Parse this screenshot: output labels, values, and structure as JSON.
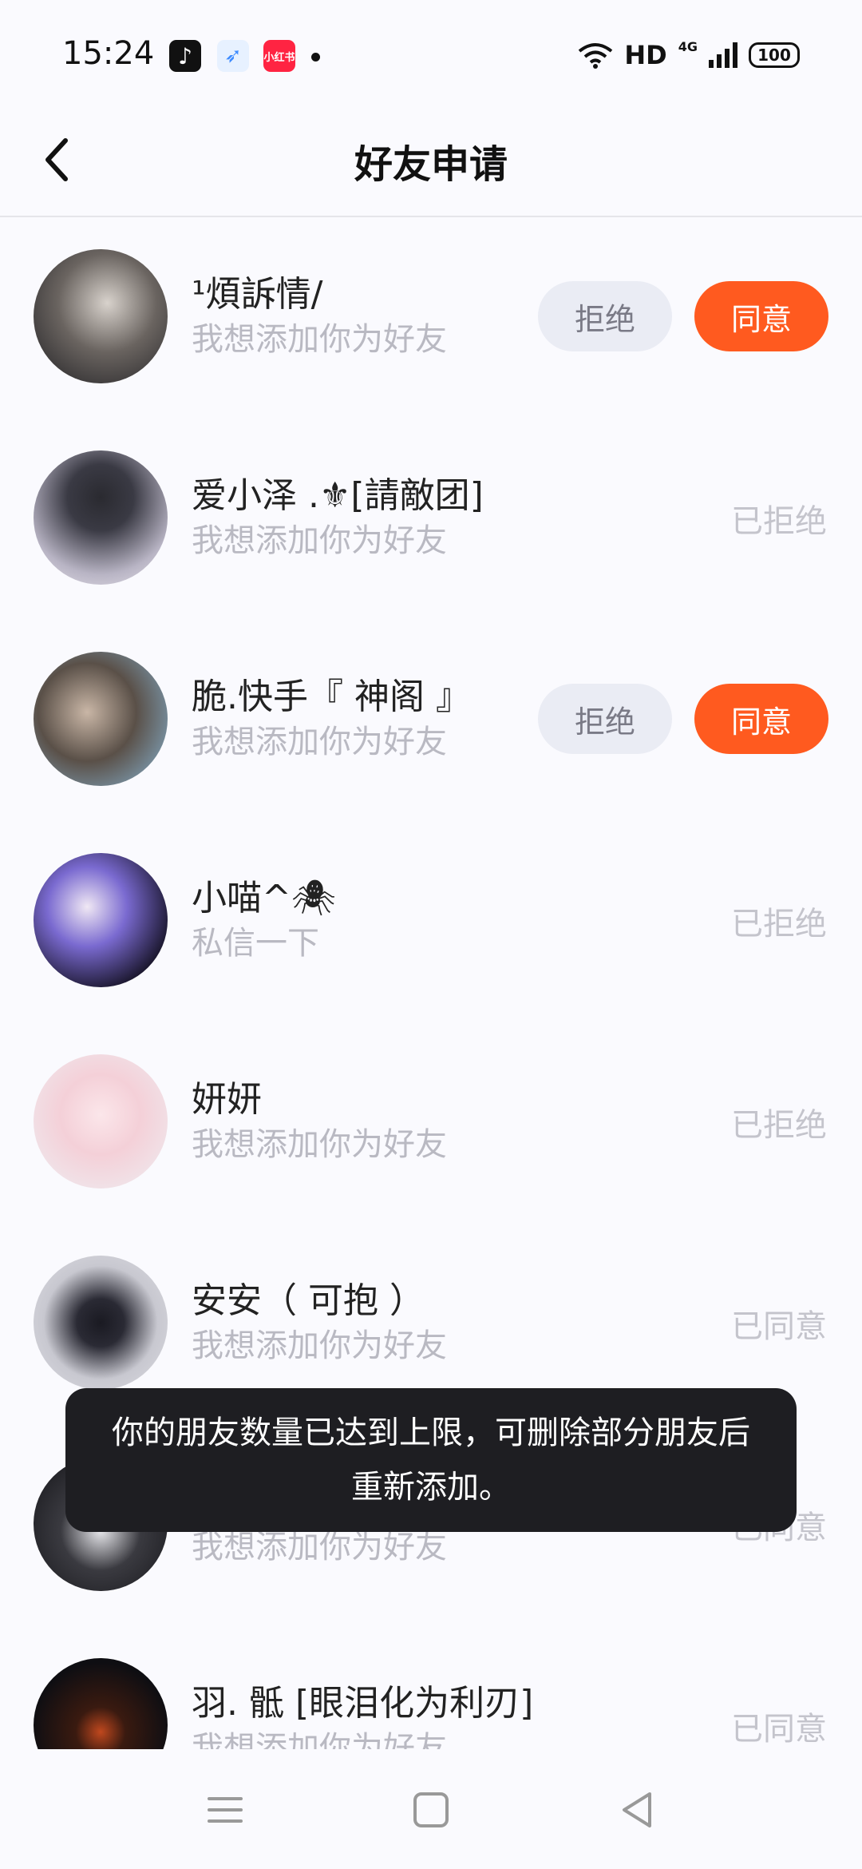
{
  "status_bar": {
    "time": "15:24",
    "apps": [
      "tiktok-icon",
      "bird-icon",
      "xiaohongshu-icon"
    ],
    "xhs_label": "小红书",
    "hd": "HD",
    "network": "4G",
    "battery": "100"
  },
  "header": {
    "title": "好友申请"
  },
  "requests": [
    {
      "name": "¹煩訴情/",
      "message": "我想添加你为好友",
      "state": "pending"
    },
    {
      "name": "爱小泽 .⚜[請敵团]",
      "message": "我想添加你为好友",
      "state": "已拒绝"
    },
    {
      "name": "脆.快手『 神阁 』",
      "message": "我想添加你为好友",
      "state": "pending"
    },
    {
      "name": "小喵^🕷",
      "message": "私信一下",
      "state": "已拒绝"
    },
    {
      "name": "妍妍",
      "message": "我想添加你为好友",
      "state": "已拒绝"
    },
    {
      "name": "安安（ 可抱 ）",
      "message": "我想添加你为好友",
      "state": "已同意"
    },
    {
      "name": "",
      "message": "我想添加你为好友",
      "state": "已同意"
    },
    {
      "name": "羽. 骶 [眼泪化为利刃]",
      "message": "我想添加你为好友",
      "state": "已同意"
    }
  ],
  "actions": {
    "reject": "拒绝",
    "agree": "同意"
  },
  "toast": {
    "text": "你的朋友数量已达到上限，可删除部分朋友后重新添加。"
  },
  "colors": {
    "accent": "#ff5a1f",
    "reject_bg": "#eaecf4",
    "toast_bg": "#1e1e22"
  }
}
